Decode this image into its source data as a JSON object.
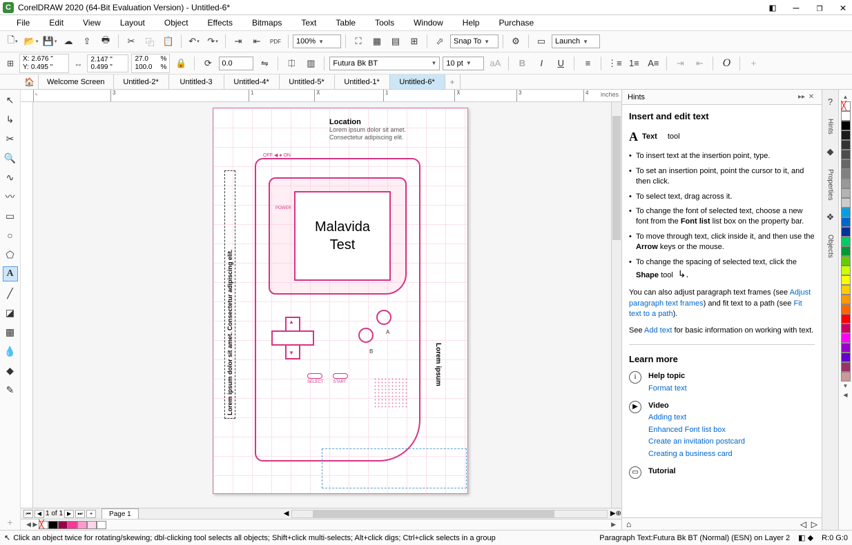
{
  "titlebar": {
    "title": "CorelDRAW 2020 (64-Bit Evaluation Version) - Untitled-6*"
  },
  "menu": [
    "File",
    "Edit",
    "View",
    "Layout",
    "Object",
    "Effects",
    "Bitmaps",
    "Text",
    "Table",
    "Tools",
    "Window",
    "Help",
    "Purchase"
  ],
  "toolbar1": {
    "zoom": "100%",
    "snap_label": "Snap To",
    "launch_label": "Launch"
  },
  "toolbar2": {
    "x": "2.676 \"",
    "y": "0.495 \"",
    "w": "2.147 \"",
    "h": "0.499 \"",
    "sx": "27.0",
    "sy": "100.0",
    "angle": "0.0",
    "font": "Futura Bk BT",
    "size": "10 pt"
  },
  "tabs": {
    "welcome": "Welcome Screen",
    "items": [
      "Untitled-2*",
      "Untitled-3",
      "Untitled-4*",
      "Untitled-5*",
      "Untitled-1*",
      "Untitled-6*"
    ],
    "active": 5
  },
  "ruler": {
    "unit": "inches"
  },
  "canvas": {
    "location_title": "Location",
    "location_body": "Lorem ipsum dolor sit amet.\nConsectetur adipiscing elit.",
    "side_text": "Lorem ipsum dolor sit amet. Consectetur adipiscing elit.",
    "lorem_side": "Lorem ipsum",
    "screen_text": "Malavida\nTest",
    "select": "SELECT",
    "start": "START",
    "a": "A",
    "b": "B",
    "power": "POWER"
  },
  "page_nav": {
    "label": "1 of 1",
    "page_tab": "Page 1"
  },
  "hints": {
    "title": "Hints",
    "section": "Insert and edit text",
    "tool_label": "Text tool",
    "bullets": [
      "To insert text at the insertion point, type.",
      "To set an insertion point, point the cursor to it, and then click.",
      "To select text, drag across it.",
      "To change the font of selected text, choose a new font from the |Font list| list box on the property bar.",
      "To move through text, click inside it, and then use the |Arrow| keys or the mouse.",
      "To change the spacing of selected text, click the |Shape| tool "
    ],
    "para1_pre": "You can also adjust paragraph text frames (see ",
    "link1": "Adjust paragraph text frames",
    "para1_mid": ") and fit text to a path (see ",
    "link2": "Fit text to a path",
    "para1_post": ").",
    "para2_pre": "See ",
    "link3": "Add text",
    "para2_post": " for basic information on working with text.",
    "learn_more": "Learn more",
    "help_topic": "Help topic",
    "help_link": "Format text",
    "video": "Video",
    "video_links": [
      "Adding text",
      "Enhanced Font list box",
      "Create an invitation postcard",
      "Creating a business card"
    ],
    "tutorial": "Tutorial"
  },
  "sidetabs": [
    "Hints",
    "Properties",
    "Objects"
  ],
  "palette": [
    "#ffffff",
    "#000000",
    "#1a1a1a",
    "#333333",
    "#4d4d4d",
    "#666666",
    "#808080",
    "#999999",
    "#b3b3b3",
    "#cccccc",
    "#00a0e3",
    "#0066cc",
    "#003399",
    "#00cc66",
    "#009933",
    "#66cc00",
    "#ccff00",
    "#ffff00",
    "#ffcc00",
    "#ff9900",
    "#ff6600",
    "#ff0000",
    "#cc0066",
    "#ff00ff",
    "#9900cc",
    "#6600cc",
    "#993366",
    "#cc9999"
  ],
  "doc_palette": [
    "#ffffff",
    "#000000",
    "#990033",
    "#ff3399",
    "#ff99cc",
    "#ffcce6",
    "#ffffff"
  ],
  "status": {
    "hint": "Click an object twice for rotating/skewing; dbl-clicking tool selects all objects; Shift+click multi-selects; Alt+click digs; Ctrl+click selects in a group",
    "object": "Paragraph Text:Futura Bk BT (Normal) (ESN) on Layer 2",
    "rgb": "R:0 G:0"
  }
}
